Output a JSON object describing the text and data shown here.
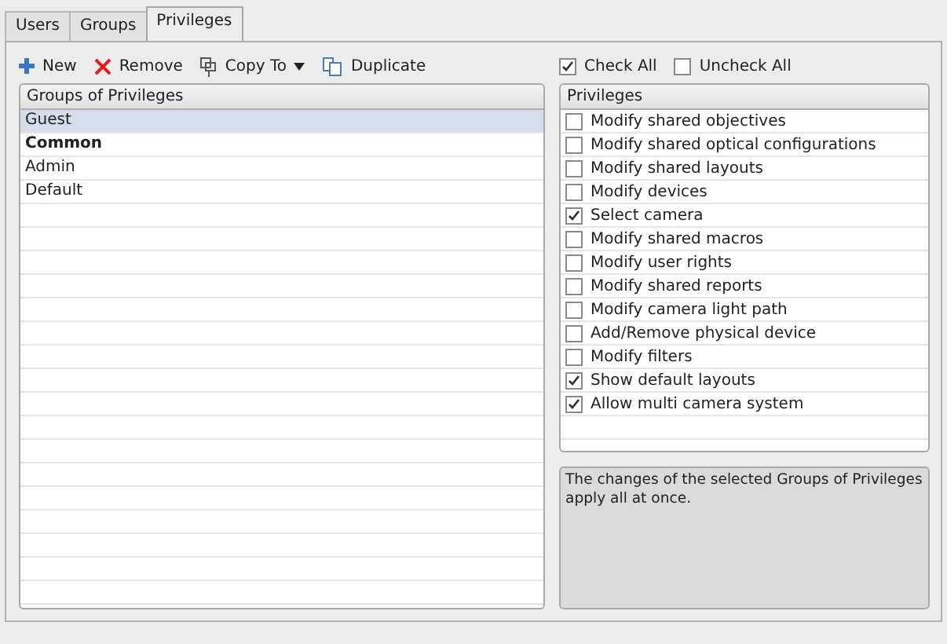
{
  "tabs": [
    {
      "label": "Users",
      "selected": false
    },
    {
      "label": "Groups",
      "selected": false
    },
    {
      "label": "Privileges",
      "selected": true
    }
  ],
  "toolbar": [
    {
      "kind": "new",
      "label": "New"
    },
    {
      "kind": "remove",
      "label": "Remove"
    },
    {
      "kind": "copy",
      "label": "Copy To",
      "dropdown": true
    },
    {
      "kind": "duplicate",
      "label": "Duplicate"
    }
  ],
  "check_all": {
    "label": "Check All",
    "checked": true
  },
  "uncheck_all": {
    "label": "Uncheck All",
    "checked": false
  },
  "groups": {
    "header": "Groups of Privileges",
    "rows": [
      {
        "label": "Guest",
        "selected": true,
        "bold": false
      },
      {
        "label": "Common",
        "selected": false,
        "bold": true
      },
      {
        "label": "Admin",
        "selected": false,
        "bold": false
      },
      {
        "label": "Default",
        "selected": false,
        "bold": false
      }
    ]
  },
  "privileges": {
    "header": "Privileges",
    "items": [
      {
        "label": "Modify shared objectives",
        "checked": false
      },
      {
        "label": "Modify shared optical configurations",
        "checked": false
      },
      {
        "label": "Modify shared layouts",
        "checked": false
      },
      {
        "label": "Modify devices",
        "checked": false
      },
      {
        "label": "Select camera",
        "checked": true
      },
      {
        "label": "Modify shared macros",
        "checked": false
      },
      {
        "label": "Modify user rights",
        "checked": false
      },
      {
        "label": "Modify shared reports",
        "checked": false
      },
      {
        "label": "Modify camera light path",
        "checked": false
      },
      {
        "label": "Add/Remove physical device",
        "checked": false
      },
      {
        "label": "Modify filters",
        "checked": false
      },
      {
        "label": "Show default layouts",
        "checked": true
      },
      {
        "label": "Allow multi camera system",
        "checked": true
      }
    ]
  },
  "description": "The changes of the selected Groups of Privileges apply all at once."
}
